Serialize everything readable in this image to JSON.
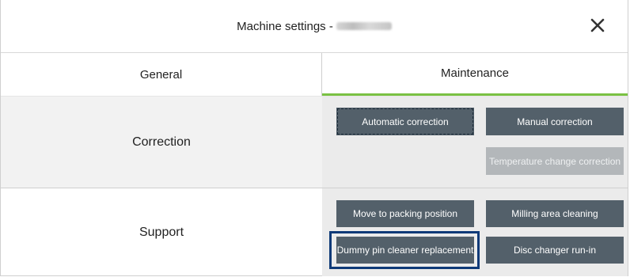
{
  "dialog": {
    "title": "Machine settings - ",
    "close_icon": "close-icon"
  },
  "tabs": [
    {
      "label": "General",
      "active": false
    },
    {
      "label": "Maintenance",
      "active": true
    }
  ],
  "colors": {
    "accent_green": "#7ac143",
    "button": "#53606a",
    "button_disabled": "#b3b7ba",
    "highlight_border": "#0f3a78"
  },
  "sections": {
    "correction": {
      "label": "Correction",
      "buttons": {
        "automatic": "Automatic correction",
        "manual": "Manual correction",
        "temperature": "Temperature change correction"
      }
    },
    "support": {
      "label": "Support",
      "buttons": {
        "packing": "Move to packing position",
        "milling": "Milling area cleaning",
        "dummy": "Dummy pin cleaner replacement",
        "disc": "Disc changer run-in"
      }
    }
  }
}
